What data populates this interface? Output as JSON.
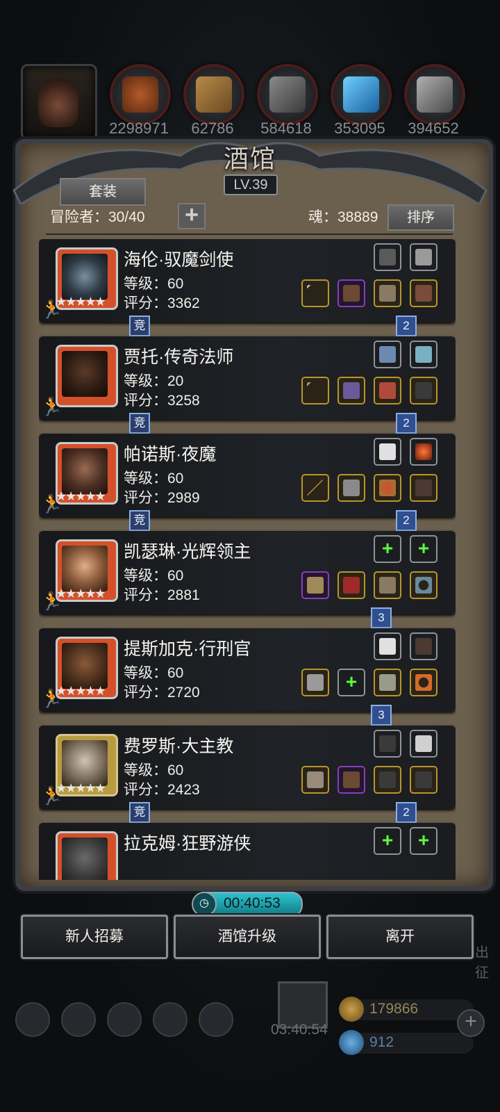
{
  "resources": {
    "values": [
      "2298971",
      "62786",
      "584618",
      "353095",
      "394652"
    ]
  },
  "panel": {
    "title": "酒馆",
    "level": "LV.39",
    "suit_label": "套装",
    "adventurers": "冒险者：30/40",
    "soul": "魂：38889",
    "sort_label": "排序",
    "plus": "+"
  },
  "heroes": [
    {
      "name": "海伦·驭魔剑使",
      "level": "等级：60",
      "score": "评分：3362",
      "stars": "★★★★★",
      "left_badge": "竞",
      "right_badge": "2"
    },
    {
      "name": "贾托·传奇法师",
      "level": "等级：20",
      "score": "评分：3258",
      "stars": "",
      "left_badge": "竞",
      "right_badge": "2"
    },
    {
      "name": "帕诺斯·夜魔",
      "level": "等级：60",
      "score": "评分：2989",
      "stars": "★★★★★",
      "left_badge": "竞",
      "right_badge": "2"
    },
    {
      "name": "凯瑟琳·光辉领主",
      "level": "等级：60",
      "score": "评分：2881",
      "stars": "★★★★★",
      "left_badge": "",
      "right_badge": "3"
    },
    {
      "name": "提斯加克·行刑官",
      "level": "等级：60",
      "score": "评分：2720",
      "stars": "★★★★★",
      "left_badge": "",
      "right_badge": "3"
    },
    {
      "name": "费罗斯·大主教",
      "level": "等级：60",
      "score": "评分：2423",
      "stars": "★★★★★",
      "left_badge": "竞",
      "right_badge": "2"
    },
    {
      "name": "拉克姆·狂野游侠",
      "level": "",
      "score": "",
      "stars": "",
      "left_badge": "",
      "right_badge": ""
    }
  ],
  "timer": "00:40:53",
  "buttons": {
    "recruit": "新人招募",
    "upgrade": "酒馆升级",
    "leave": "离开"
  },
  "bottom": {
    "gift_timer": "03:40:54",
    "gold": "179866",
    "gem": "912",
    "side_text": "出征"
  },
  "colors": {
    "gold_text": "#9a8752",
    "gem_text": "#5b7fa8",
    "plus_green": "#5aff3a"
  }
}
